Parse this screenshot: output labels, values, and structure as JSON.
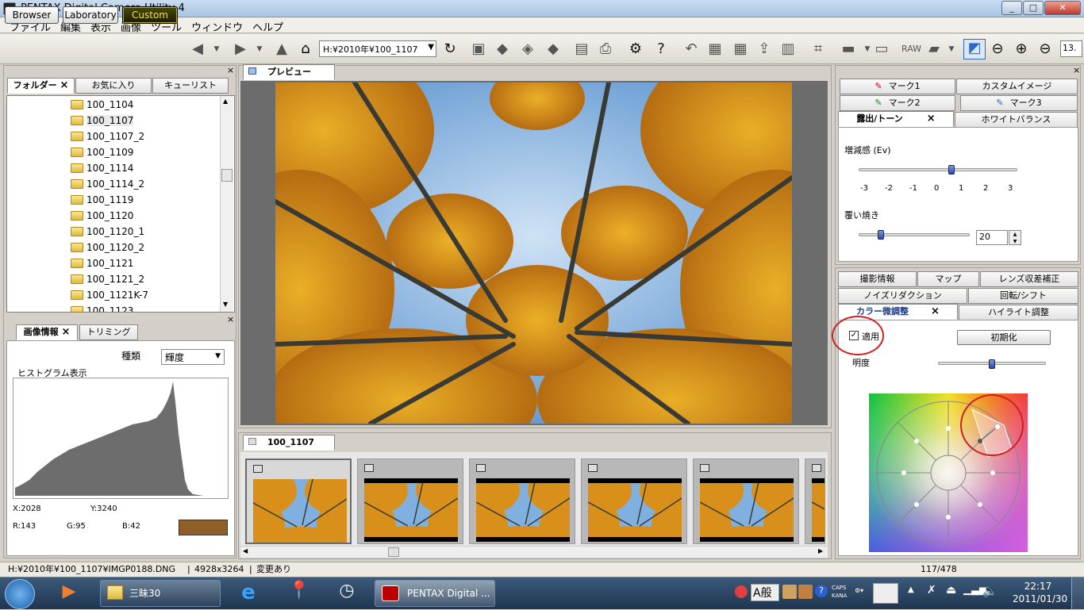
{
  "window": {
    "title": "PENTAX Digital Camera Utility 4",
    "min": "_",
    "max": "□",
    "close": "✕"
  },
  "menu": [
    "ファイル",
    "編集",
    "表示",
    "画像",
    "ツール",
    "ウィンドウ",
    "ヘルプ"
  ],
  "modes": {
    "browser": "Browser",
    "laboratory": "Laboratory",
    "custom": "Custom"
  },
  "toolbar": {
    "path": "H:¥2010年¥100_1107",
    "zoom": "13."
  },
  "left_tabs": {
    "folder": "フォルダー",
    "favorites": "お気に入り",
    "queue": "キューリスト"
  },
  "folders": [
    {
      "name": "100_1104",
      "selected": false
    },
    {
      "name": "100_1107",
      "selected": true
    },
    {
      "name": "100_1107_2",
      "selected": false
    },
    {
      "name": "100_1109",
      "selected": false
    },
    {
      "name": "100_1114",
      "selected": false
    },
    {
      "name": "100_1114_2",
      "selected": false
    },
    {
      "name": "100_1119",
      "selected": false
    },
    {
      "name": "100_1120",
      "selected": false
    },
    {
      "name": "100_1120_1",
      "selected": false
    },
    {
      "name": "100_1120_2",
      "selected": false
    },
    {
      "name": "100_1121",
      "selected": false
    },
    {
      "name": "100_1121_2",
      "selected": false
    },
    {
      "name": "100_1121K-7",
      "selected": false
    },
    {
      "name": "100_1123",
      "selected": false
    }
  ],
  "info_tabs": {
    "image_info": "画像情報",
    "trimming": "トリミング"
  },
  "histogram": {
    "kind_label": "種類",
    "kind_value": "輝度",
    "title": "ヒストグラム表示",
    "x": "X:2028",
    "y": "Y:3240",
    "r": "R:143",
    "g": "G:95",
    "b": "B:42",
    "swatch": "#8f5f2a"
  },
  "preview": {
    "tab": "プレビュー"
  },
  "thumbs": {
    "tab": "100_1107",
    "count": 6
  },
  "right_tabs": {
    "mark1": "マーク1",
    "custom_image": "カスタムイメージ",
    "mark2": "マーク2",
    "mark3": "マーク3",
    "exposure": "露出/トーン",
    "white_balance": "ホワイトバランス"
  },
  "exposure": {
    "ev_label": "増減感 (Ev)",
    "ticks": [
      "-3",
      "-2",
      "-1",
      "0",
      "1",
      "2",
      "3"
    ],
    "ev_value": 0.5,
    "burn_label": "覆い焼き",
    "burn_value": "20",
    "burn_fraction": 0.2
  },
  "right_tabs2": {
    "shooting_info": "撮影情報",
    "map": "マップ",
    "lens": "レンズ収差補正",
    "noise": "ノイズリダクション",
    "rotate": "回転/シフト",
    "color": "カラー微調整",
    "highlight": "ハイライト調整"
  },
  "color_adjust": {
    "apply_label": "適用",
    "reset": "初期化",
    "brightness_label": "明度",
    "brightness_fraction": 0.5
  },
  "status": {
    "path": "H:¥2010年¥100_1107¥IMGP0188.DNG",
    "size": "4928x3264",
    "changed": "変更あり",
    "count": "117/478"
  },
  "taskbar": {
    "explorer_task": "三昧30",
    "pentax_task": "PENTAX Digital ...",
    "ime1": "A",
    "ime2": "般",
    "caps": "CAPS",
    "kana": "KANA",
    "time": "22:17",
    "date": "2011/01/30"
  },
  "colors": {
    "accent": "#316ac5",
    "custom_btn_text": "#f0e060",
    "red_marker": "#d02020"
  }
}
